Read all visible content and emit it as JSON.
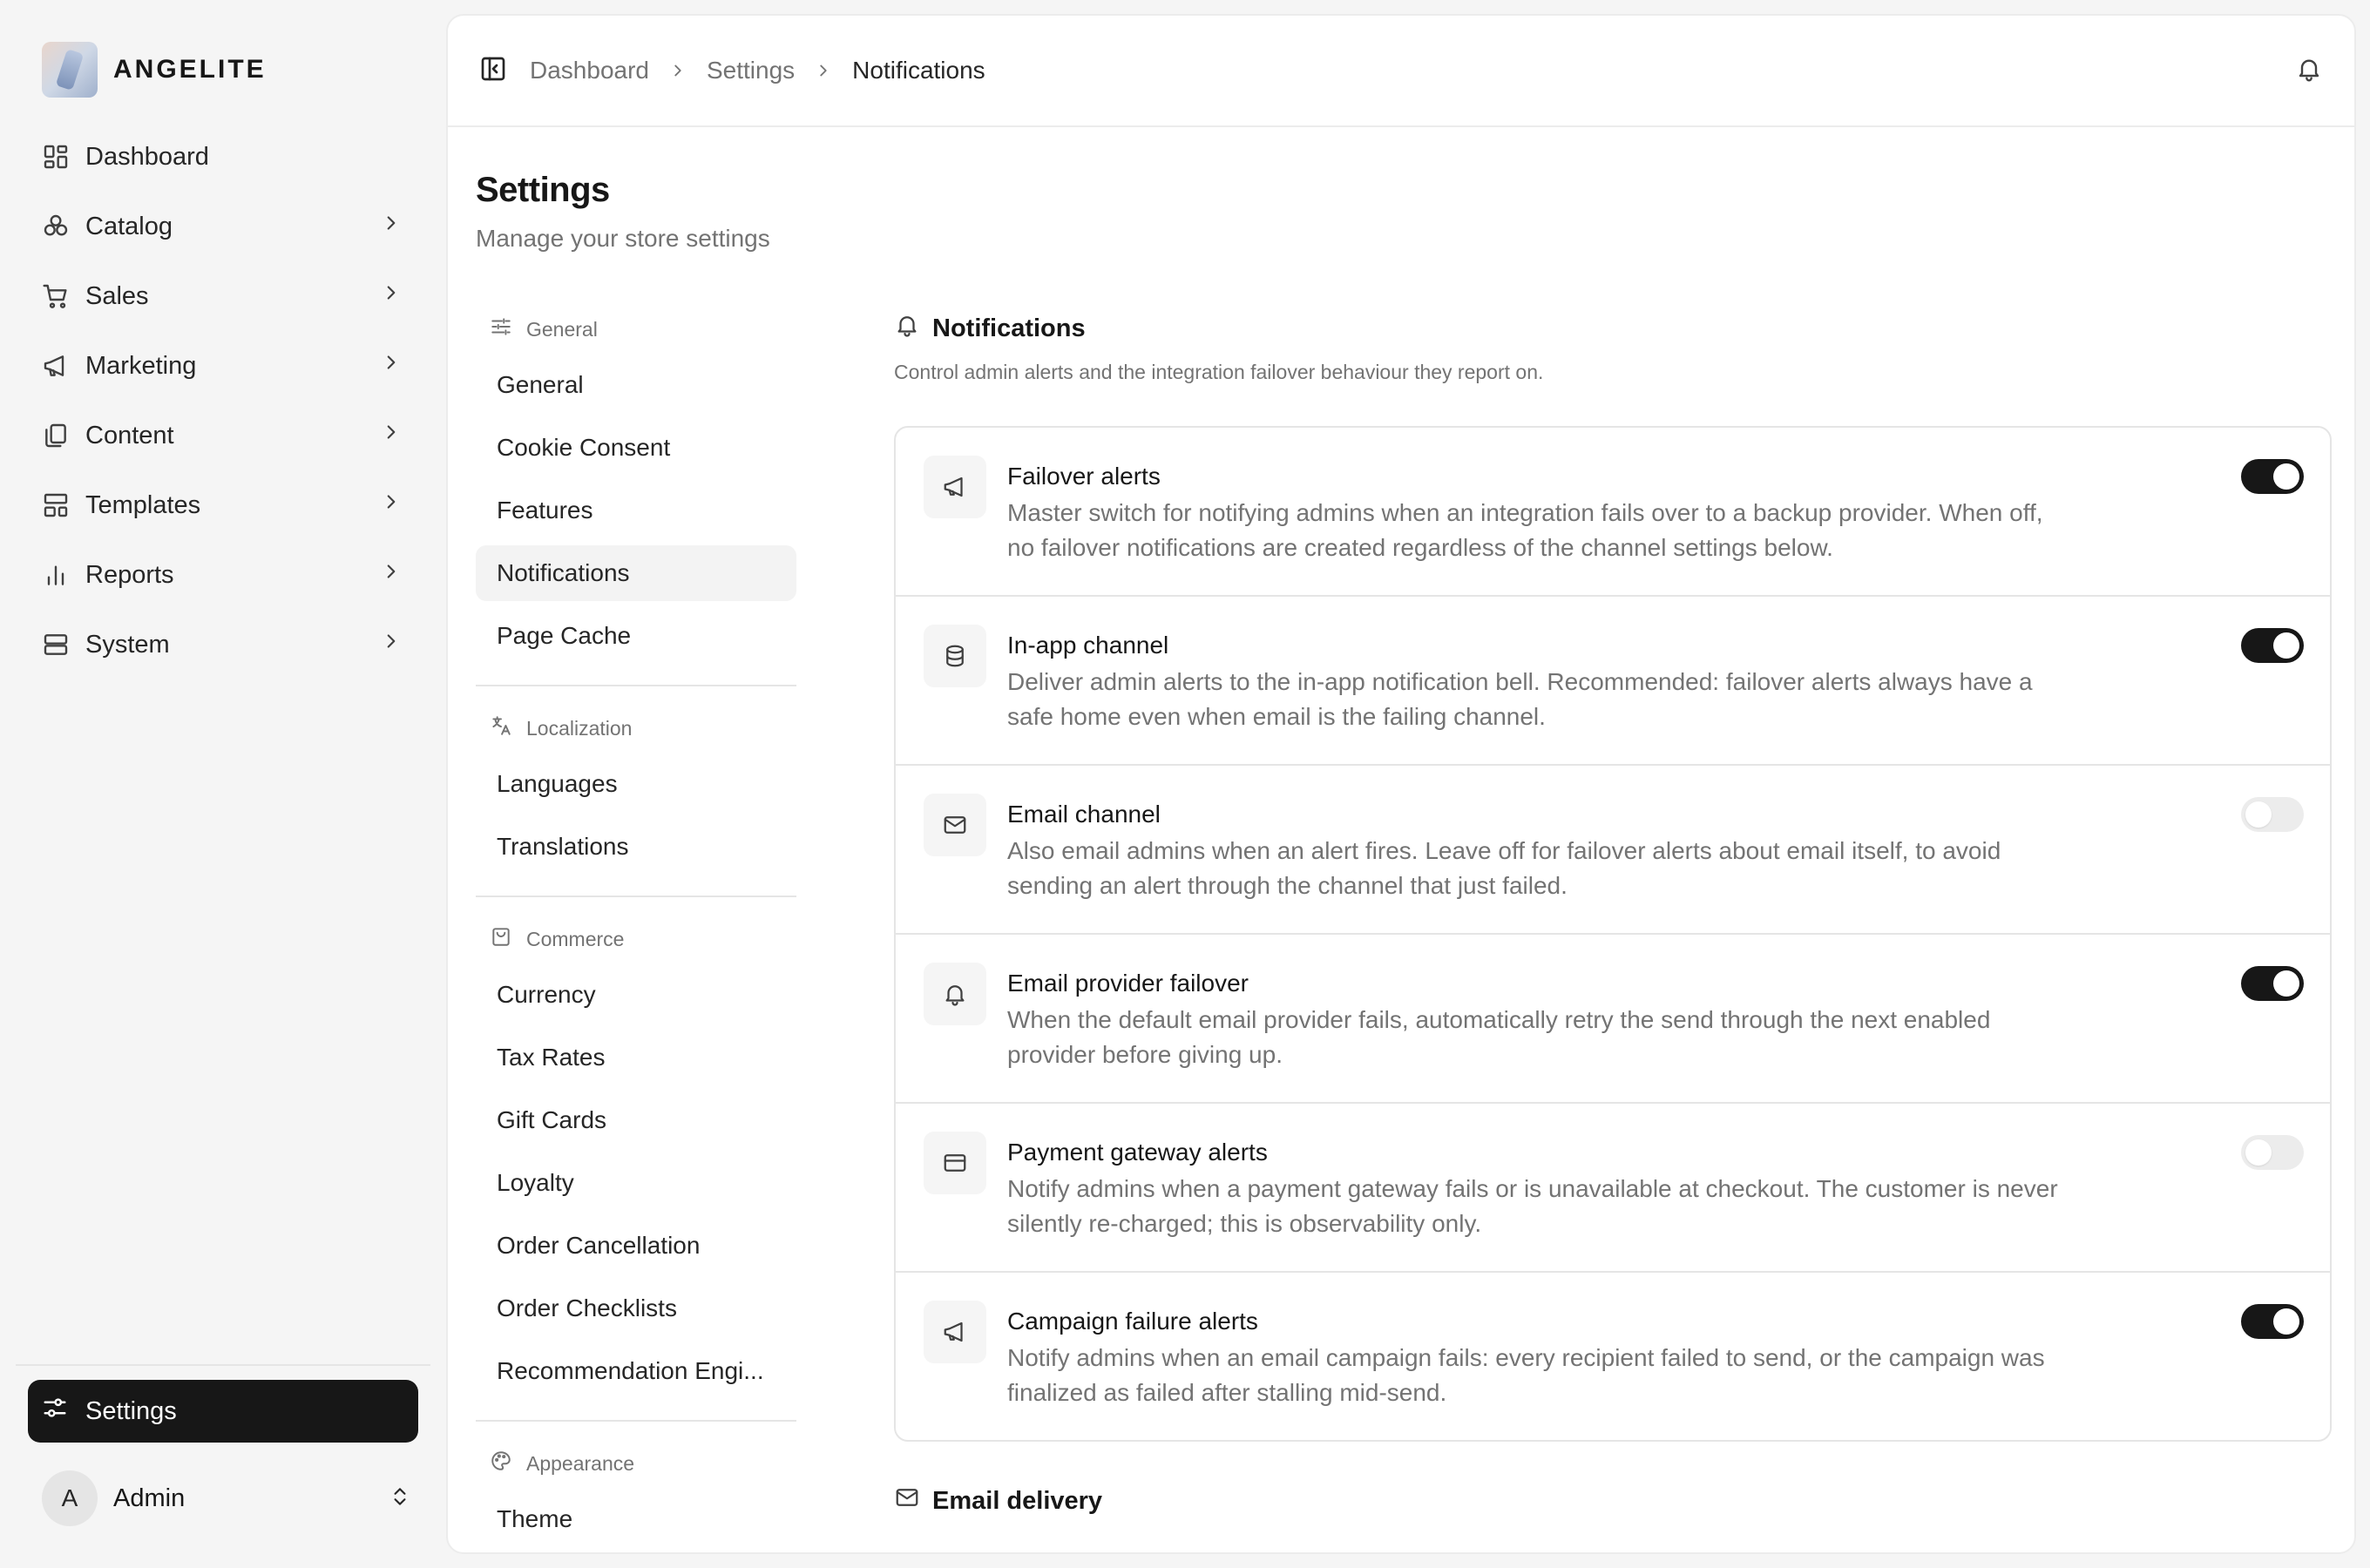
{
  "brand": {
    "name": "ANGELITE"
  },
  "sidebar": {
    "items": [
      {
        "label": "Dashboard",
        "icon": "dashboard-icon"
      },
      {
        "label": "Catalog",
        "icon": "catalog-icon"
      },
      {
        "label": "Sales",
        "icon": "cart-icon"
      },
      {
        "label": "Marketing",
        "icon": "megaphone-icon"
      },
      {
        "label": "Content",
        "icon": "content-icon"
      },
      {
        "label": "Templates",
        "icon": "templates-icon"
      },
      {
        "label": "Reports",
        "icon": "reports-icon"
      },
      {
        "label": "System",
        "icon": "server-icon"
      }
    ],
    "settings_label": "Settings",
    "user": {
      "initial": "A",
      "name": "Admin"
    }
  },
  "breadcrumb": [
    "Dashboard",
    "Settings",
    "Notifications"
  ],
  "page": {
    "title": "Settings",
    "subtitle": "Manage your store settings"
  },
  "subnav": {
    "groups": [
      {
        "title": "General",
        "items": [
          "General",
          "Cookie Consent",
          "Features",
          "Notifications",
          "Page Cache"
        ]
      },
      {
        "title": "Localization",
        "items": [
          "Languages",
          "Translations"
        ]
      },
      {
        "title": "Commerce",
        "items": [
          "Currency",
          "Tax Rates",
          "Gift Cards",
          "Loyalty",
          "Order Cancellation",
          "Order Checklists",
          "Recommendation Engi..."
        ]
      },
      {
        "title": "Appearance",
        "items": [
          "Theme"
        ]
      }
    ],
    "active": "Notifications"
  },
  "notifications": {
    "title": "Notifications",
    "description": "Control admin alerts and the integration failover behaviour they report on.",
    "rows": [
      {
        "title": "Failover alerts",
        "description": "Master switch for notifying admins when an integration fails over to a backup provider. When off, no failover notifications are created regardless of the channel settings below.",
        "enabled": true,
        "icon": "megaphone-icon"
      },
      {
        "title": "In-app channel",
        "description": "Deliver admin alerts to the in-app notification bell. Recommended: failover alerts always have a safe home even when email is the failing channel.",
        "enabled": true,
        "icon": "database-icon"
      },
      {
        "title": "Email channel",
        "description": "Also email admins when an alert fires. Leave off for failover alerts about email itself, to avoid sending an alert through the channel that just failed.",
        "enabled": false,
        "icon": "mail-icon"
      },
      {
        "title": "Email provider failover",
        "description": "When the default email provider fails, automatically retry the send through the next enabled provider before giving up.",
        "enabled": true,
        "icon": "bell-icon"
      },
      {
        "title": "Payment gateway alerts",
        "description": "Notify admins when a payment gateway fails or is unavailable at checkout. The customer is never silently re-charged; this is observability only.",
        "enabled": false,
        "icon": "credit-card-icon"
      },
      {
        "title": "Campaign failure alerts",
        "description": "Notify admins when an email campaign fails: every recipient failed to send, or the campaign was finalized as failed after stalling mid-send.",
        "enabled": true,
        "icon": "megaphone-icon"
      }
    ]
  },
  "email_delivery": {
    "title": "Email delivery"
  },
  "colors": {
    "accent": "#171717",
    "muted": "#737373",
    "border": "#e5e5e5",
    "toggle_off": "#ececec"
  }
}
